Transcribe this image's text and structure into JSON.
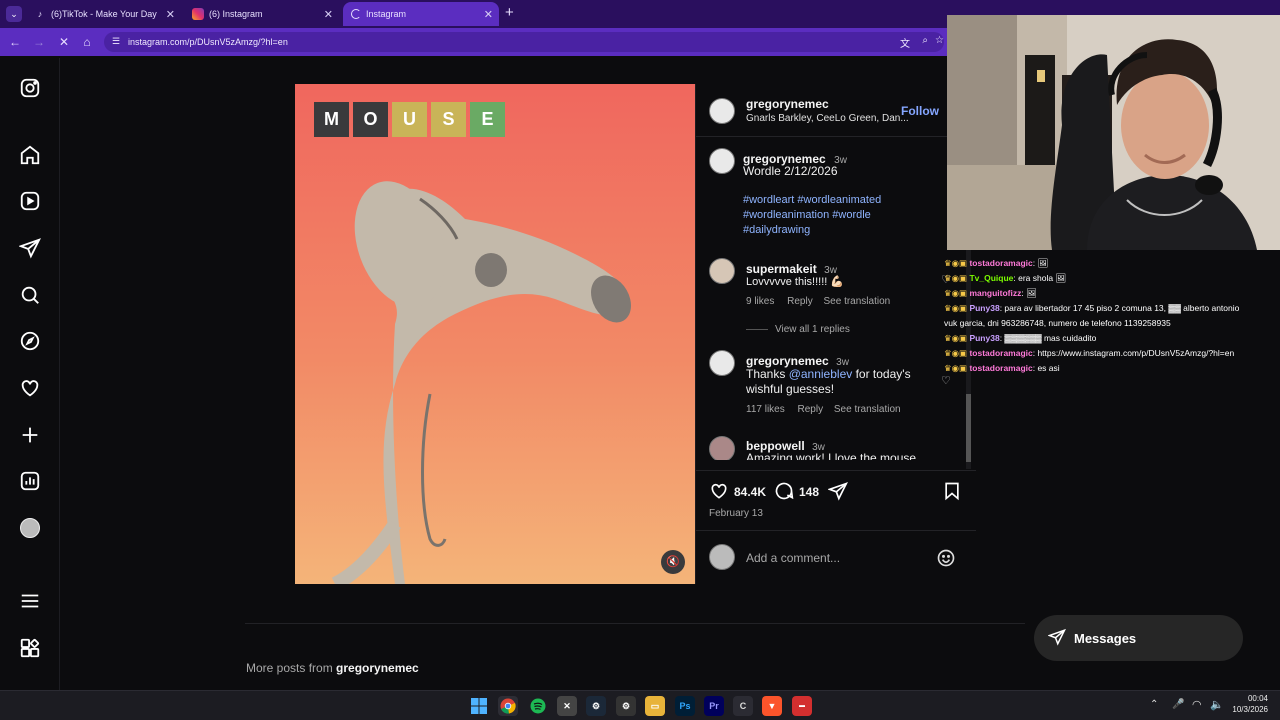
{
  "browser": {
    "tabs": [
      {
        "label": "(6)TikTok - Make Your Day",
        "icon": "tiktok-icon"
      },
      {
        "label": "(6) Instagram",
        "icon": "instagram-icon"
      },
      {
        "label": "Instagram",
        "icon": "loading-icon"
      }
    ],
    "new_tab": "+",
    "url": "instagram.com/p/DUsnV5zAmzg/?hl=en"
  },
  "post": {
    "tiles": [
      "M",
      "O",
      "U",
      "S",
      "E"
    ],
    "tile_colors": [
      "#3a3a3c",
      "#3a3a3c",
      "#c9b458",
      "#c9b458",
      "#6aaa64"
    ],
    "author": "gregorynemec",
    "follow_label": "Follow",
    "audio": "Gnarls Barkley, CeeLo Green, Dan...",
    "caption_user": "gregorynemec",
    "caption_time": "3w",
    "caption_text": "Wordle 2/12/2026",
    "hashtags_line1": "#wordleart #wordleanimated",
    "hashtags_line2": "#wordleanimation #wordle",
    "hashtags_line3": "#dailydrawing",
    "comments": [
      {
        "user": "supermakeit",
        "time": "3w",
        "text": "Lovvvvve this!!!!! 💪🏻",
        "likes": "9 likes",
        "reply": "Reply",
        "translate": "See translation",
        "view_replies": "View all 1 replies"
      },
      {
        "user": "gregorynemec",
        "time": "3w",
        "text_pre": "Thanks ",
        "mention": "@annieblev",
        "text_post": " for today's",
        "text_line2": "wishful guesses!",
        "likes": "117 likes",
        "reply": "Reply",
        "translate": "See translation"
      },
      {
        "user": "beppowell",
        "time": "3w",
        "text": "Amazing work! I love the mouse"
      }
    ],
    "like_count": "84.4K",
    "comment_count": "148",
    "date": "February 13",
    "add_comment_placeholder": "Add a comment...",
    "more_posts_prefix": "More posts from ",
    "more_posts_user": "gregorynemec",
    "messages_label": "Messages"
  },
  "chat": [
    {
      "user": "tostadoramagic",
      "text": ": 🖼",
      "color": "#ff7ad9"
    },
    {
      "user": "Tv_Quique",
      "text": ": era shola 🖼",
      "color": "#7cfc00"
    },
    {
      "user": "manguitofizz",
      "text": ": 🖼",
      "color": "#ff7ad9"
    },
    {
      "user": "Puny38",
      "text": ": para av libertador 17 45 piso 2 comuna 13, ▓▓ alberto antonio",
      "color": "#c9a0ff"
    },
    {
      "user": "",
      "text": "vuk garcia, dni 963286748, numero de telefono 1139258935",
      "color": "#ffffff"
    },
    {
      "user": "Puny38",
      "text": ": ▓▓▓▓▓▓ mas cuidadito",
      "color": "#c9a0ff"
    },
    {
      "user": "tostadoramagic",
      "text": ": https://www.instagram.com/p/DUsnV5zAmzg/?hl=en",
      "color": "#ff7ad9"
    },
    {
      "user": "tostadoramagic",
      "text": ": es asi",
      "color": "#ff7ad9"
    }
  ],
  "taskbar": {
    "time": "00:04",
    "date": "10/3/2026"
  },
  "colors": {
    "tab_bar": "#2a0f5e",
    "address_bar": "#5b2dc0",
    "link_blue": "#8fb4ff",
    "follow_blue": "#85a6ff"
  }
}
